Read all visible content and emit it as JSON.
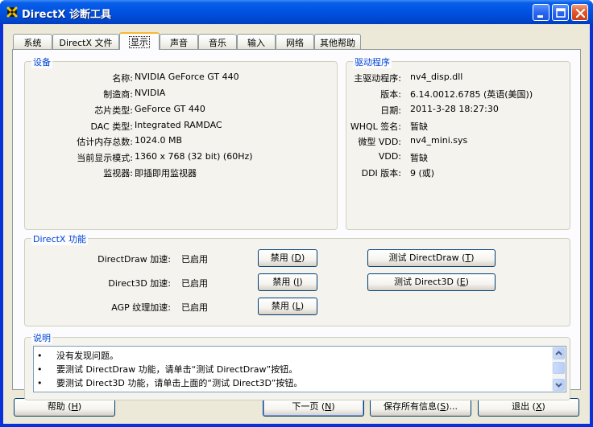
{
  "window": {
    "title": "DirectX 诊断工具"
  },
  "tabs": [
    {
      "label": "系统"
    },
    {
      "label": "DirectX 文件"
    },
    {
      "label": "显示"
    },
    {
      "label": "声音"
    },
    {
      "label": "音乐"
    },
    {
      "label": "输入"
    },
    {
      "label": "网络"
    },
    {
      "label": "其他帮助"
    }
  ],
  "device": {
    "title": "设备",
    "rows": [
      {
        "label": "名称:",
        "value": "NVIDIA GeForce GT 440"
      },
      {
        "label": "制造商:",
        "value": "NVIDIA"
      },
      {
        "label": "芯片类型:",
        "value": "GeForce GT 440"
      },
      {
        "label": "DAC 类型:",
        "value": "Integrated RAMDAC"
      },
      {
        "label": "估计内存总数:",
        "value": "1024.0 MB"
      },
      {
        "label": "当前显示模式:",
        "value": "1360 x 768 (32 bit) (60Hz)"
      },
      {
        "label": "监视器:",
        "value": "即插即用监视器"
      }
    ]
  },
  "driver": {
    "title": "驱动程序",
    "rows": [
      {
        "label": "主驱动程序:",
        "value": "nv4_disp.dll"
      },
      {
        "label": "版本:",
        "value": "6.14.0012.6785 (英语(美国))"
      },
      {
        "label": "日期:",
        "value": "2011-3-28 18:27:30"
      },
      {
        "label": "WHQL 签名:",
        "value": "暂缺"
      },
      {
        "label": "微型 VDD:",
        "value": "nv4_mini.sys"
      },
      {
        "label": "VDD:",
        "value": "暂缺"
      },
      {
        "label": "DDI 版本:",
        "value": "9 (或)"
      }
    ]
  },
  "features": {
    "title": "DirectX 功能",
    "rows": [
      {
        "label": "DirectDraw 加速:",
        "value": "已启用",
        "disable": "禁用",
        "disable_key": "D",
        "test": "测试 DirectDraw",
        "test_key": "T"
      },
      {
        "label": "Direct3D 加速:",
        "value": "已启用",
        "disable": "禁用",
        "disable_key": "I",
        "test": "测试 Direct3D",
        "test_key": "E"
      },
      {
        "label": "AGP 纹理加速:",
        "value": "已启用",
        "disable": "禁用",
        "disable_key": "L"
      }
    ]
  },
  "notes": {
    "title": "说明",
    "lines": [
      "没有发现问题。",
      "要测试 DirectDraw 功能，请单击“测试 DirectDraw”按钮。",
      "要测试 Direct3D 功能，请单击上面的“测试 Direct3D”按钮。"
    ]
  },
  "footer": {
    "help": "帮助",
    "help_key": "H",
    "next": "下一页",
    "next_key": "N",
    "save": "保存所有信息",
    "save_key": "S",
    "save_suffix": "...",
    "exit": "退出",
    "exit_key": "X"
  }
}
